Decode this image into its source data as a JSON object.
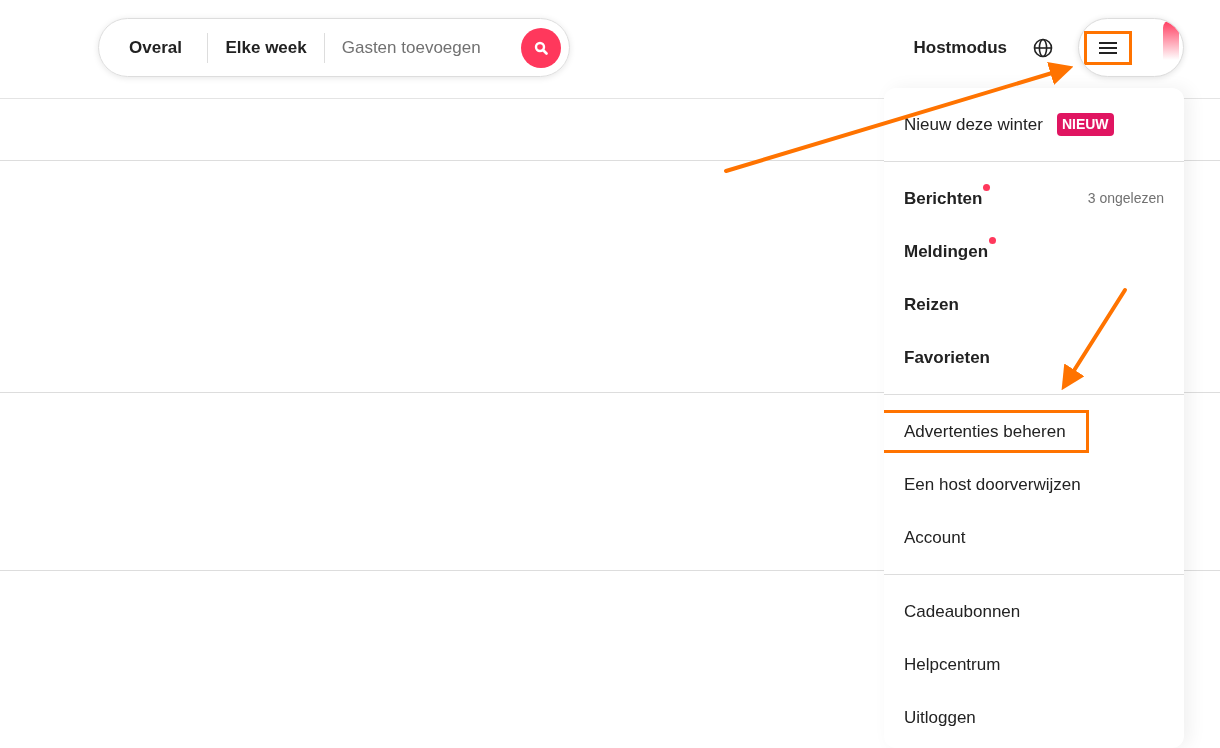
{
  "search": {
    "location": "Overal",
    "dates": "Elke week",
    "guests": "Gasten toevoegen"
  },
  "header": {
    "host_mode": "Hostmodus",
    "menu_button": {
      "annotated": true
    }
  },
  "menu": {
    "sections": [
      {
        "kind": "regular",
        "items": [
          {
            "label": "Nieuw deze winter",
            "badge": "NIEUW",
            "dot": false,
            "annotated": false
          }
        ]
      },
      {
        "kind": "bold",
        "items": [
          {
            "label": "Berichten",
            "dot": true,
            "note": "3 ongelezen",
            "annotated": false
          },
          {
            "label": "Meldingen",
            "dot": true,
            "annotated": false
          },
          {
            "label": "Reizen",
            "dot": false,
            "annotated": false
          },
          {
            "label": "Favorieten",
            "dot": false,
            "annotated": false
          }
        ]
      },
      {
        "kind": "regular",
        "items": [
          {
            "label": "Advertenties beheren",
            "dot": false,
            "annotated": true
          },
          {
            "label": "Een host doorverwijzen",
            "dot": false,
            "annotated": false
          },
          {
            "label": "Account",
            "dot": false,
            "annotated": false
          }
        ]
      },
      {
        "kind": "regular",
        "items": [
          {
            "label": "Cadeaubonnen",
            "dot": false,
            "annotated": false
          },
          {
            "label": "Helpcentrum",
            "dot": false,
            "annotated": false
          },
          {
            "label": "Uitloggen",
            "dot": false,
            "annotated": false
          }
        ]
      }
    ]
  }
}
